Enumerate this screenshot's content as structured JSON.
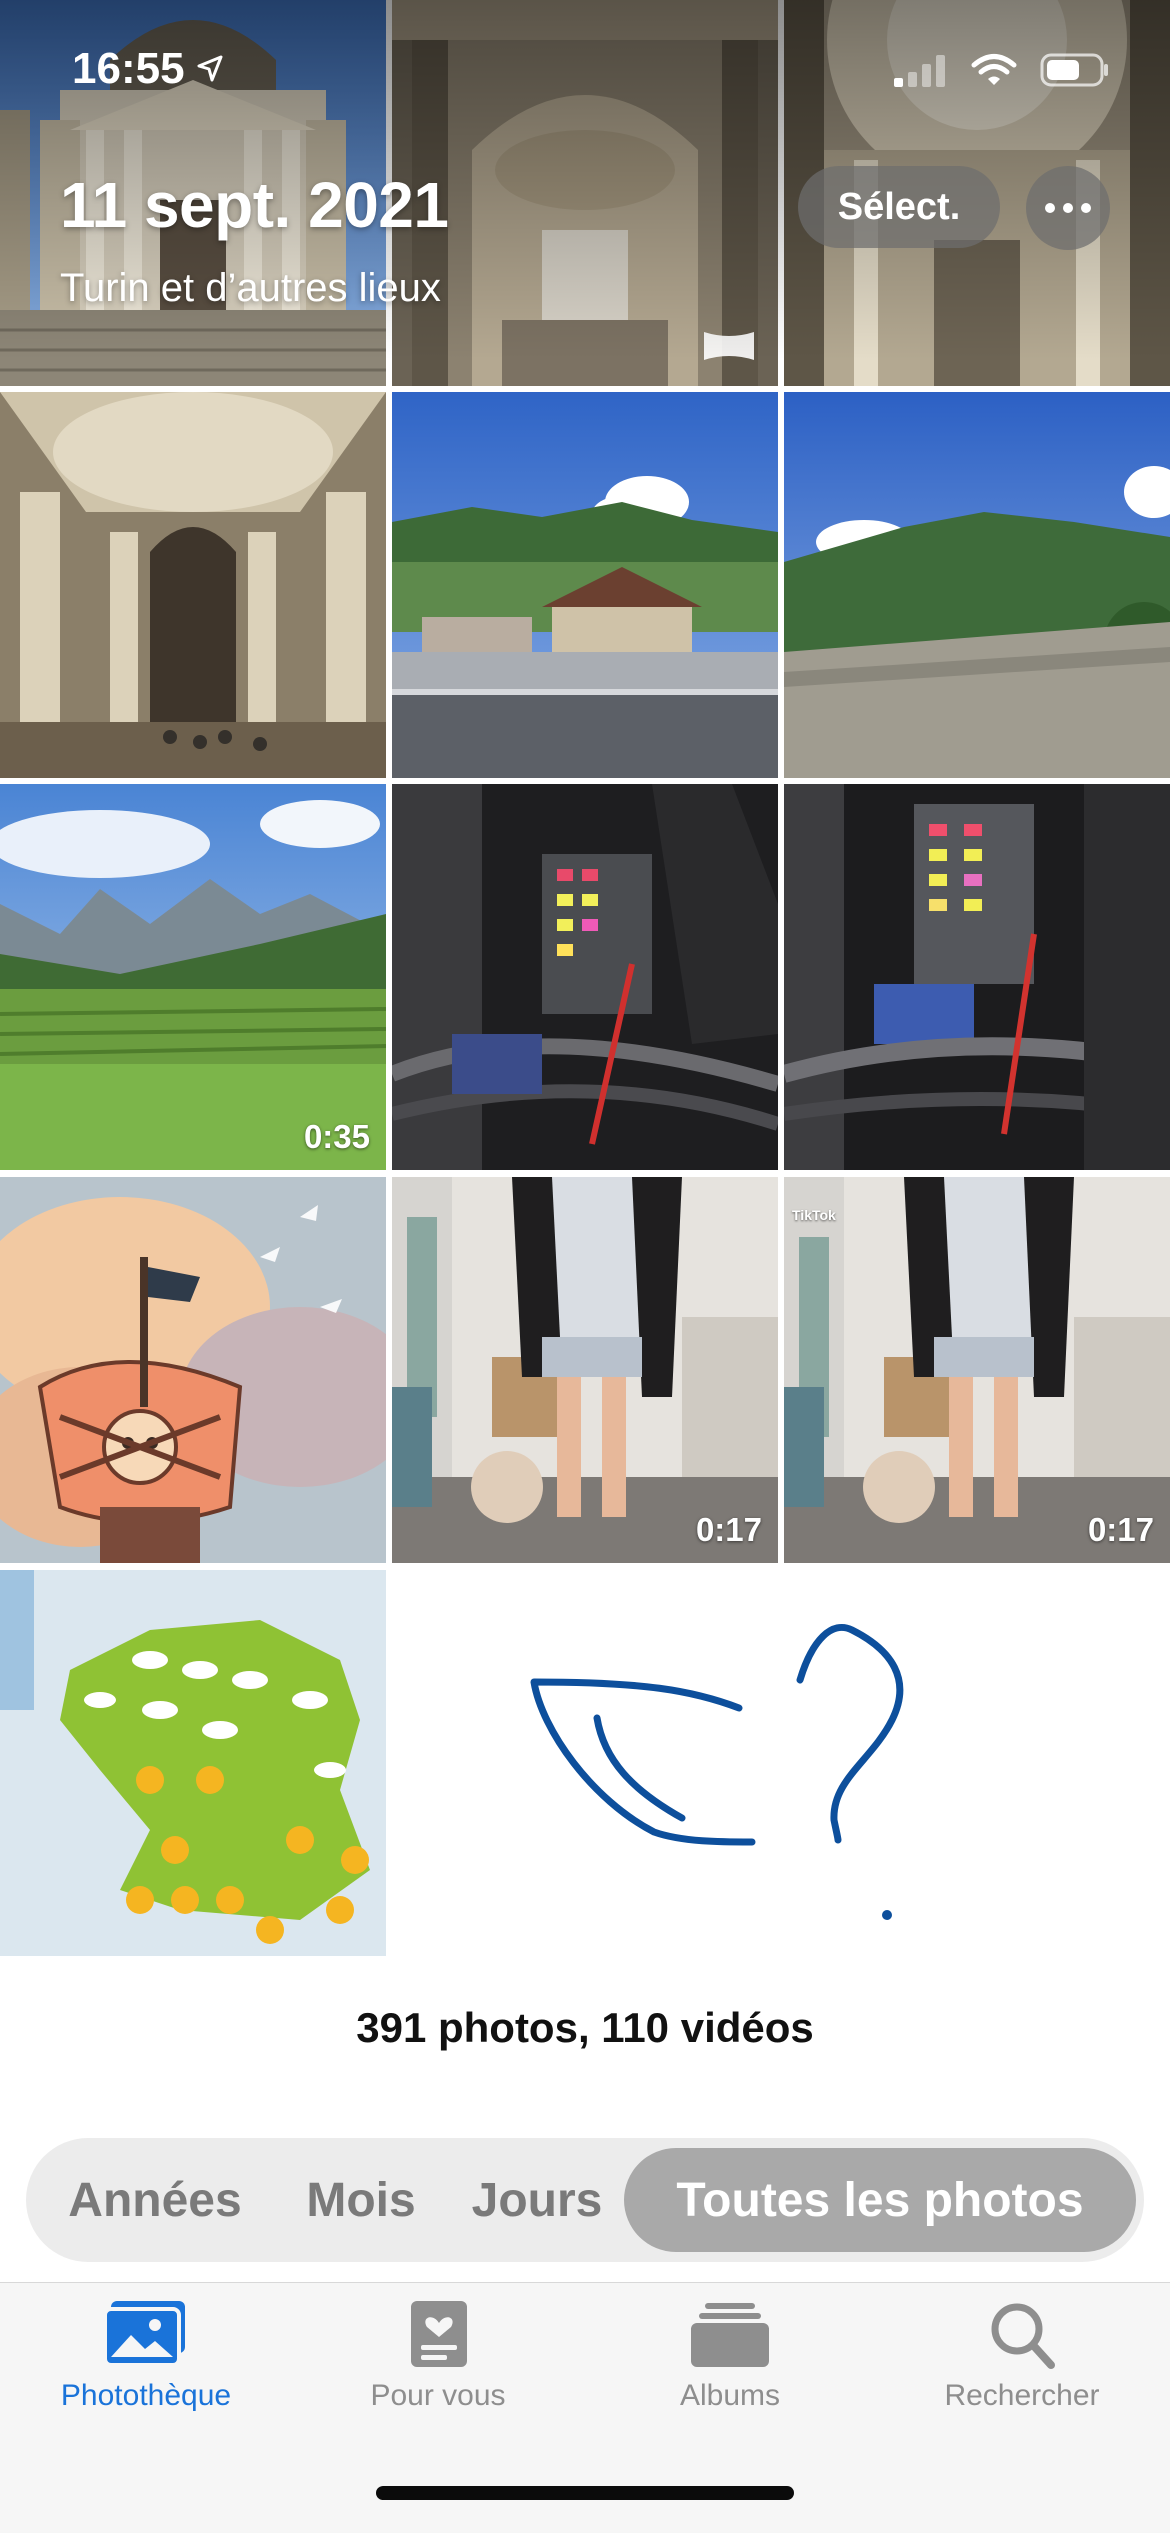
{
  "status_bar": {
    "time": "16:55"
  },
  "header": {
    "date_title": "11 sept. 2021",
    "location": "Turin et d’autres lieux",
    "select_label": "Sélect."
  },
  "grid": {
    "durations": {
      "meadow_video": "0:35",
      "dance_video_1": "0:17",
      "dance_video_2": "0:17"
    },
    "tiktok_watermark": "TikTok"
  },
  "summary": {
    "count_text": "391 photos, 110 vidéos"
  },
  "segmented_control": {
    "items": [
      "Années",
      "Mois",
      "Jours",
      "Toutes les photos"
    ],
    "selected": "Toutes les photos"
  },
  "tab_bar": {
    "items": [
      {
        "label": "Photothèque",
        "icon": "photo-library-icon",
        "active": true
      },
      {
        "label": "Pour vous",
        "icon": "for-you-icon",
        "active": false
      },
      {
        "label": "Albums",
        "icon": "albums-icon",
        "active": false
      },
      {
        "label": "Rechercher",
        "icon": "search-icon",
        "active": false
      }
    ]
  },
  "colors": {
    "accent": "#1a73d9",
    "sketch_ink": "#0d4f9c"
  }
}
